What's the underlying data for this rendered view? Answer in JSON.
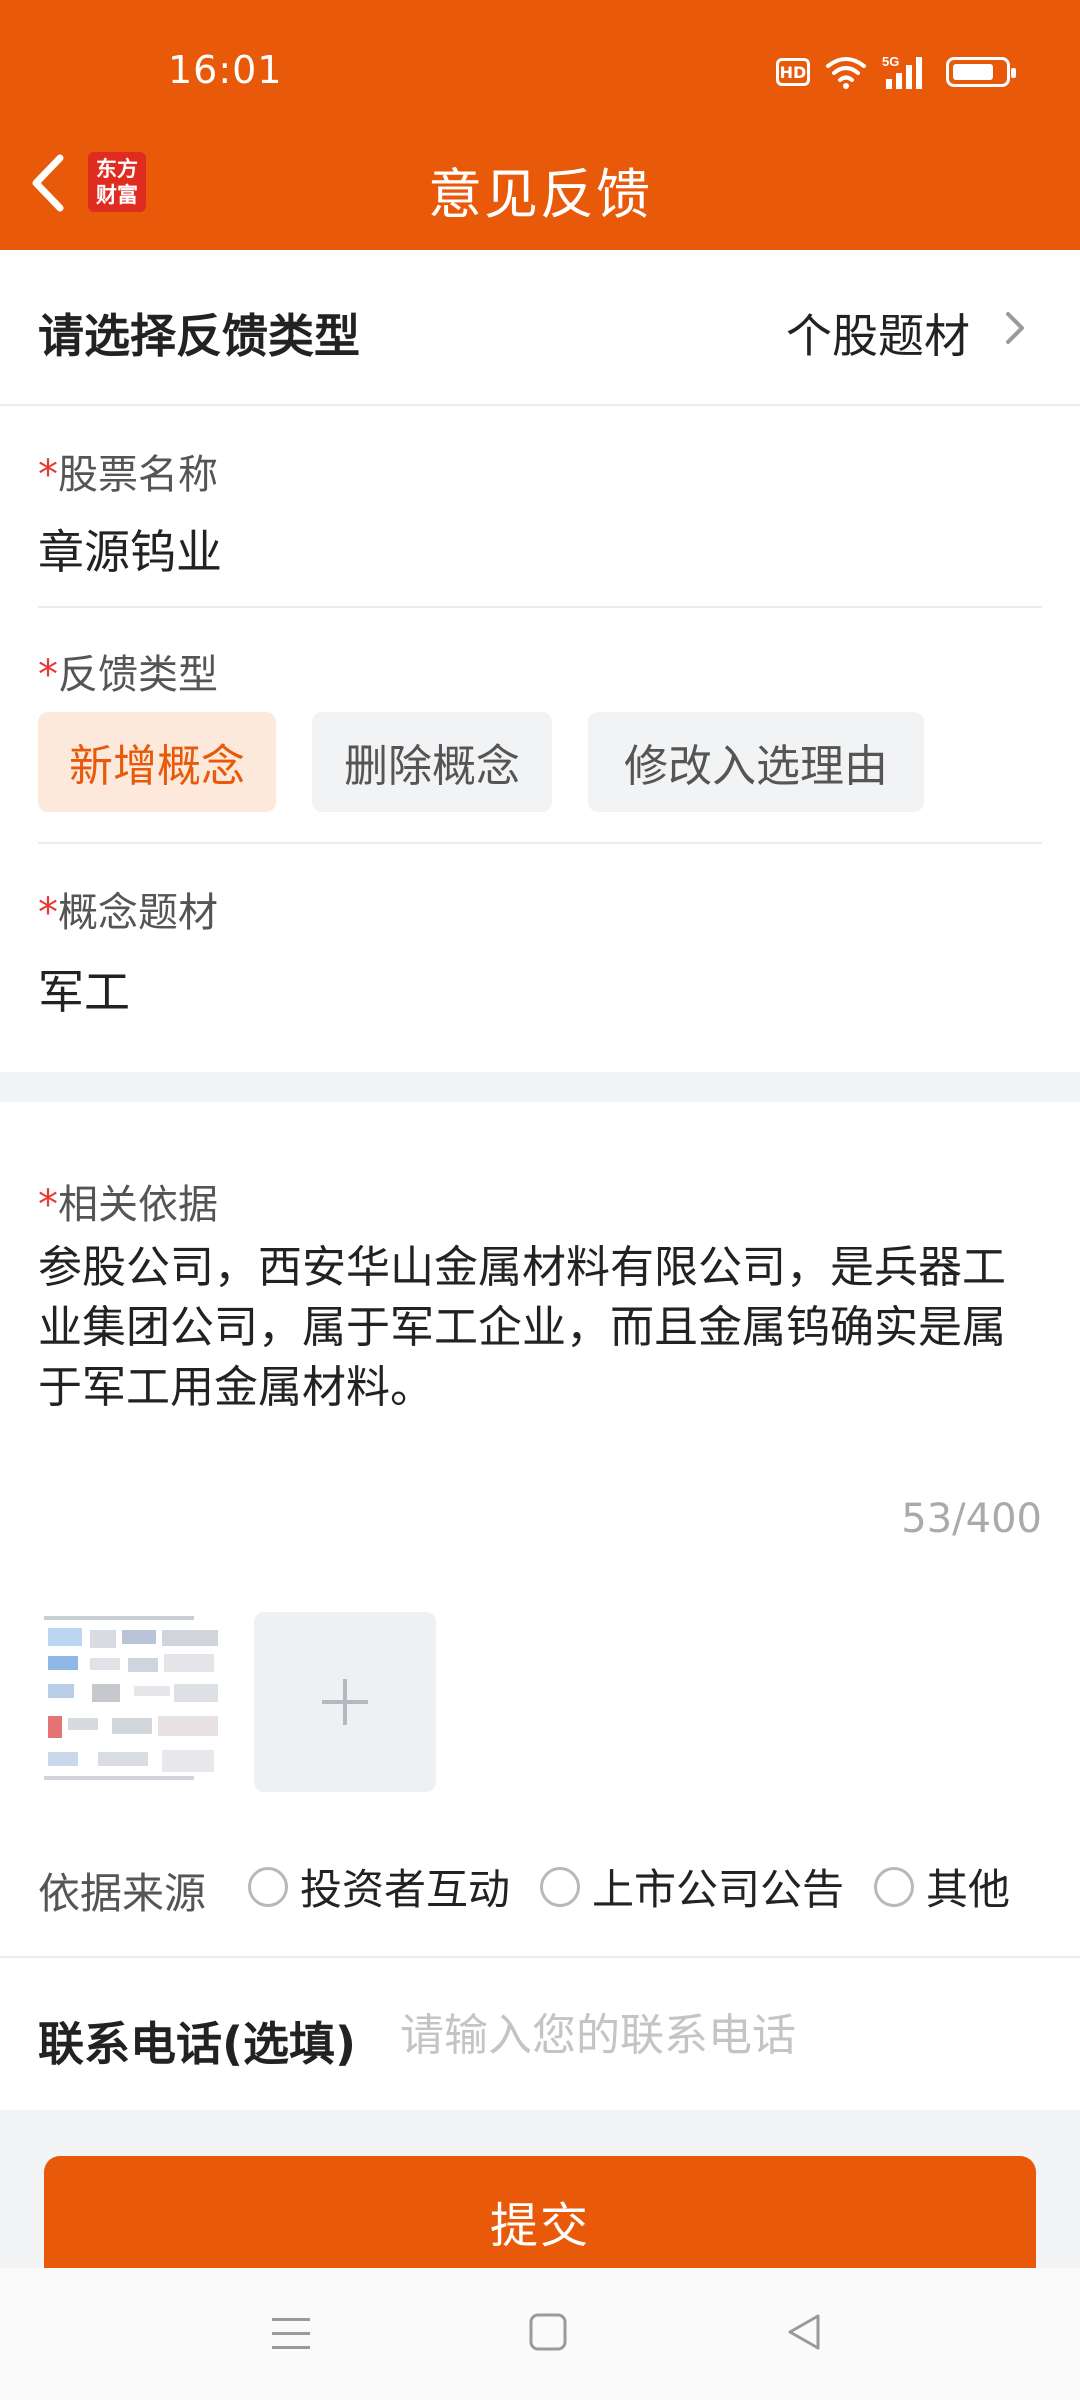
{
  "status_bar": {
    "time": "16:01",
    "hd_label": "HD",
    "network": "5G",
    "icons": [
      "hd-icon",
      "wifi-icon",
      "signal-icon",
      "battery-icon"
    ]
  },
  "header": {
    "title": "意见反馈",
    "logo_text_line1": "东方",
    "logo_text_line2": "财富",
    "back_icon": "chevron-left-icon"
  },
  "feedback_type_row": {
    "label": "请选择反馈类型",
    "value": "个股题材"
  },
  "stock_name": {
    "required_mark": "*",
    "label": "股票名称",
    "value": "章源钨业"
  },
  "feedback_category": {
    "required_mark": "*",
    "label": "反馈类型",
    "options": [
      "新增概念",
      "删除概念",
      "修改入选理由"
    ],
    "selected": "新增概念"
  },
  "concept_theme": {
    "required_mark": "*",
    "label": "概念题材",
    "value": "军工"
  },
  "basis": {
    "required_mark": "*",
    "label": "相关依据",
    "text": "参股公司，西安华山金属材料有限公司，是兵器工业集团公司，属于军工企业，而且金属钨确实是属于军工用金属材料。",
    "counter": "53/400"
  },
  "source": {
    "label": "依据来源",
    "options": [
      "投资者互动",
      "上市公司公告",
      "其他"
    ]
  },
  "phone": {
    "label": "联系电话(选填)",
    "placeholder": "请输入您的联系电话"
  },
  "submit": {
    "label": "提交"
  },
  "colors": {
    "brand": "#e85a0a",
    "required": "#e53935",
    "chip_active_bg": "#fde9dc"
  },
  "nav_bar": {
    "icons": [
      "menu-icon",
      "home-square-icon",
      "back-triangle-icon"
    ]
  }
}
